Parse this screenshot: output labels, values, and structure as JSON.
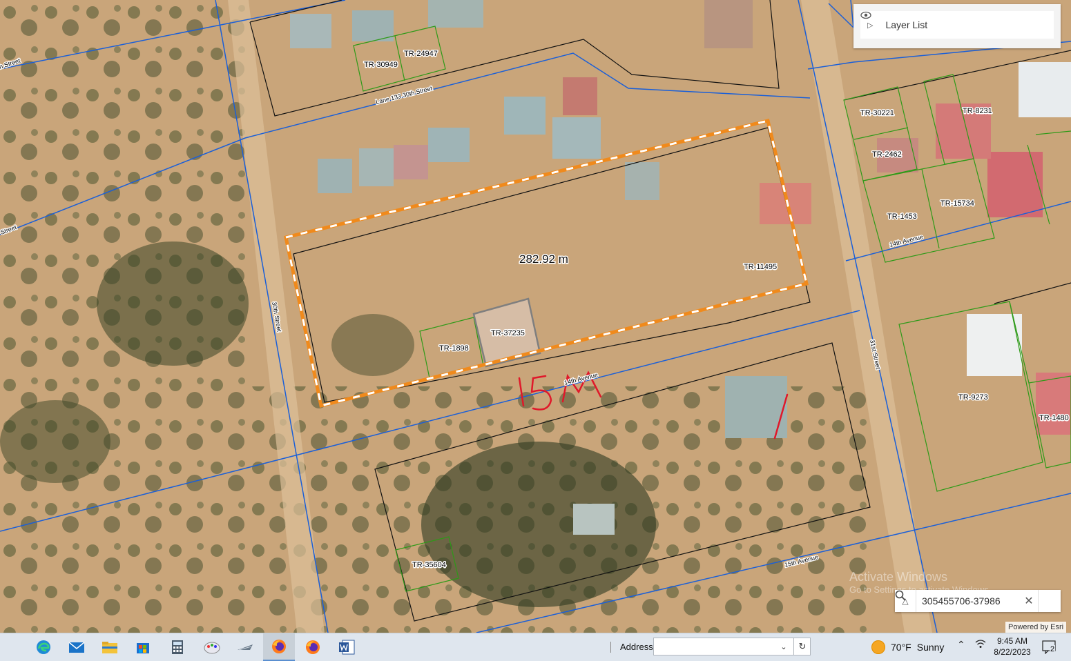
{
  "map": {
    "measurement": "282.92 m",
    "handwritten_note": "15M",
    "parcels": [
      "TR-30949",
      "TR-24947",
      "TR-30221",
      "TR-8231",
      "TR-2462",
      "TR-1453",
      "TR-15734",
      "TR-11495",
      "TR-37235",
      "TR-1898",
      "TR-9273",
      "TR-1480",
      "TR-35604"
    ],
    "streets": [
      "Lane 133 30th Street",
      "30th Street",
      "31st Street",
      "14th Avenue",
      "14th Avenue",
      "15th Avenue",
      "h Street",
      "Street"
    ]
  },
  "layer_list": {
    "label": "Layer List",
    "icons": [
      "expand-triangle-icon",
      "eye-icon"
    ]
  },
  "search": {
    "value": "305455706-37986"
  },
  "attribution": "Powered by Esri",
  "watermark": {
    "line1": "Activate Windows",
    "line2": "Go to Settings to activate Windows."
  },
  "taskbar": {
    "apps": [
      "edge-icon",
      "mail-icon",
      "file-explorer-icon",
      "store-icon",
      "calculator-icon",
      "paint-icon",
      "snipping-icon",
      "firefox-icon",
      "firefox-icon",
      "word-icon"
    ],
    "address_label": "Address",
    "address_value": "",
    "weather": {
      "temp": "70°F",
      "condition": "Sunny"
    },
    "time": "9:45 AM",
    "date": "8/22/2023",
    "notifications": "2"
  },
  "colors": {
    "boundary_blue": "#1a5fd8",
    "parcel_green": "#2e9a18",
    "parcel_black": "#111111",
    "measure_orange": "#f08a1c",
    "ink_red": "#e0182a",
    "taskbar": "#dfe6ee"
  }
}
